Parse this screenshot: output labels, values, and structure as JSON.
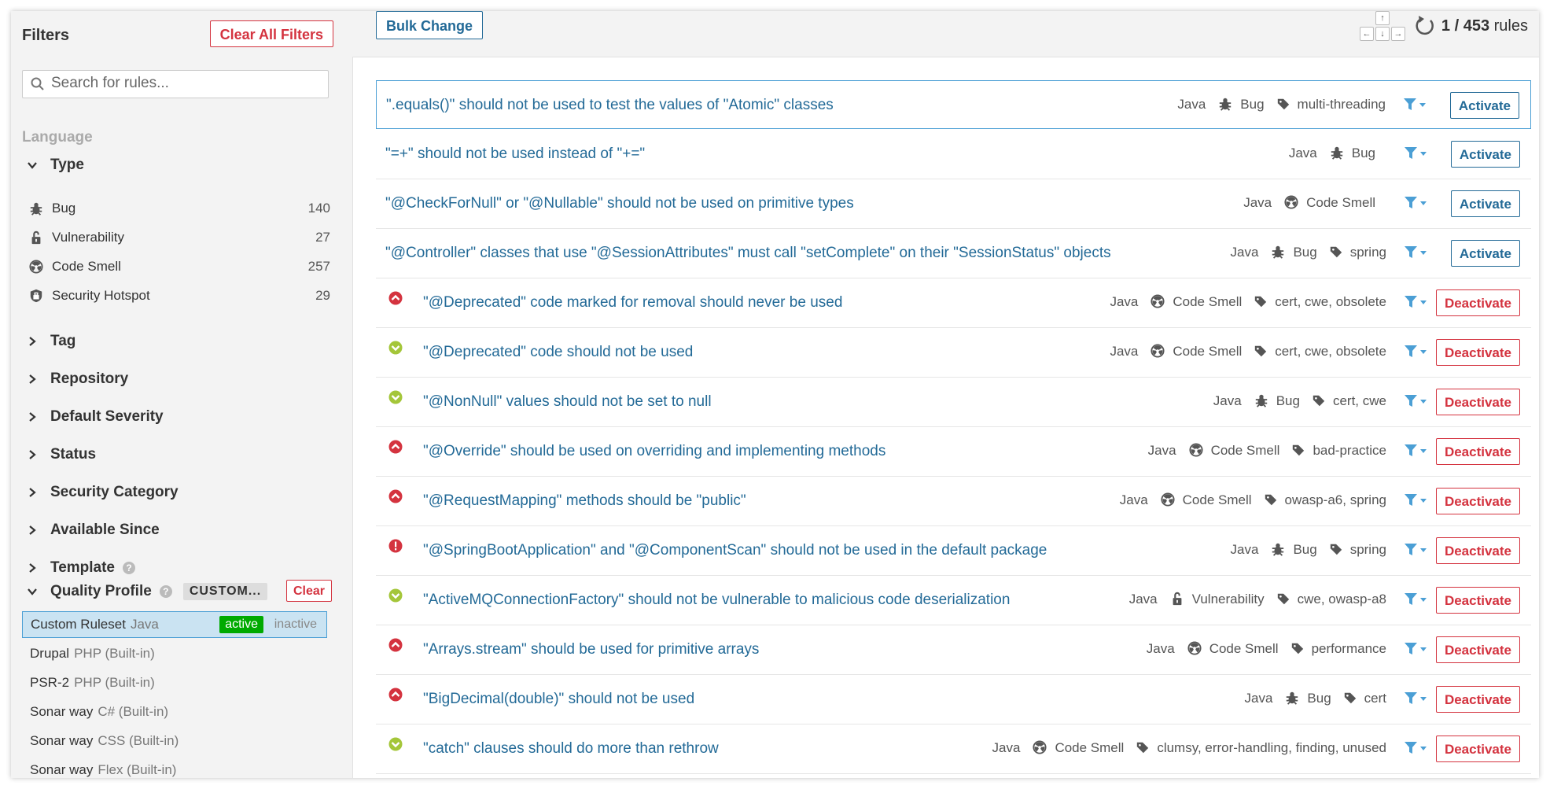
{
  "sidebar": {
    "title": "Filters",
    "clear_all": "Clear All Filters",
    "search_placeholder": "Search for rules...",
    "language_label": "Language",
    "type": {
      "label": "Type",
      "items": [
        {
          "label": "Bug",
          "count": "140",
          "icon": "bug-icon"
        },
        {
          "label": "Vulnerability",
          "count": "27",
          "icon": "lock-icon"
        },
        {
          "label": "Code Smell",
          "count": "257",
          "icon": "code-smell-icon"
        },
        {
          "label": "Security Hotspot",
          "count": "29",
          "icon": "shield-icon"
        }
      ]
    },
    "facets": [
      "Tag",
      "Repository",
      "Default Severity",
      "Status",
      "Security Category",
      "Available Since",
      "Template"
    ],
    "quality_profile": {
      "label": "Quality Profile",
      "chip": "CUSTOM...",
      "clear": "Clear",
      "active_badge": "active",
      "inactive_badge": "inactive",
      "profiles": [
        {
          "name": "Custom Ruleset",
          "lang": "Java",
          "selected": true
        },
        {
          "name": "Drupal",
          "lang": "PHP (Built-in)"
        },
        {
          "name": "PSR-2",
          "lang": "PHP (Built-in)"
        },
        {
          "name": "Sonar way",
          "lang": "C# (Built-in)"
        },
        {
          "name": "Sonar way",
          "lang": "CSS (Built-in)"
        },
        {
          "name": "Sonar way",
          "lang": "Flex (Built-in)"
        }
      ]
    }
  },
  "toolbar": {
    "bulk_change": "Bulk Change",
    "count_current": "1 / 453",
    "count_unit": "rules"
  },
  "colors": {
    "link": "#236a97",
    "danger": "#d4333f",
    "active": "#00aa00",
    "major": "#d4333f",
    "minor": "#a4c639"
  },
  "rules": [
    {
      "title": "\".equals()\" should not be used to test the values of \"Atomic\" classes",
      "lang": "Java",
      "type": "Bug",
      "tags": "multi-threading",
      "action": "Activate",
      "severity": null,
      "highlight": true
    },
    {
      "title": "\"=+\" should not be used instead of \"+=\"",
      "lang": "Java",
      "type": "Bug",
      "tags": "",
      "action": "Activate",
      "severity": null
    },
    {
      "title": "\"@CheckForNull\" or \"@Nullable\" should not be used on primitive types",
      "lang": "Java",
      "type": "Code Smell",
      "tags": "",
      "action": "Activate",
      "severity": null
    },
    {
      "title": "\"@Controller\" classes that use \"@SessionAttributes\" must call \"setComplete\" on their \"SessionStatus\" objects",
      "lang": "Java",
      "type": "Bug",
      "tags": "spring",
      "action": "Activate",
      "severity": null
    },
    {
      "title": "\"@Deprecated\" code marked for removal should never be used",
      "lang": "Java",
      "type": "Code Smell",
      "tags": "cert, cwe, obsolete",
      "action": "Deactivate",
      "severity": "major"
    },
    {
      "title": "\"@Deprecated\" code should not be used",
      "lang": "Java",
      "type": "Code Smell",
      "tags": "cert, cwe, obsolete",
      "action": "Deactivate",
      "severity": "minor"
    },
    {
      "title": "\"@NonNull\" values should not be set to null",
      "lang": "Java",
      "type": "Bug",
      "tags": "cert, cwe",
      "action": "Deactivate",
      "severity": "minor"
    },
    {
      "title": "\"@Override\" should be used on overriding and implementing methods",
      "lang": "Java",
      "type": "Code Smell",
      "tags": "bad-practice",
      "action": "Deactivate",
      "severity": "major"
    },
    {
      "title": "\"@RequestMapping\" methods should be \"public\"",
      "lang": "Java",
      "type": "Code Smell",
      "tags": "owasp-a6, spring",
      "action": "Deactivate",
      "severity": "major"
    },
    {
      "title": "\"@SpringBootApplication\" and \"@ComponentScan\" should not be used in the default package",
      "lang": "Java",
      "type": "Bug",
      "tags": "spring",
      "action": "Deactivate",
      "severity": "blocker"
    },
    {
      "title": "\"ActiveMQConnectionFactory\" should not be vulnerable to malicious code deserialization",
      "lang": "Java",
      "type": "Vulnerability",
      "tags": "cwe, owasp-a8",
      "action": "Deactivate",
      "severity": "minor"
    },
    {
      "title": "\"Arrays.stream\" should be used for primitive arrays",
      "lang": "Java",
      "type": "Code Smell",
      "tags": "performance",
      "action": "Deactivate",
      "severity": "major"
    },
    {
      "title": "\"BigDecimal(double)\" should not be used",
      "lang": "Java",
      "type": "Bug",
      "tags": "cert",
      "action": "Deactivate",
      "severity": "major"
    },
    {
      "title": "\"catch\" clauses should do more than rethrow",
      "lang": "Java",
      "type": "Code Smell",
      "tags": "clumsy, error-handling, finding, unused",
      "action": "Deactivate",
      "severity": "minor"
    }
  ]
}
